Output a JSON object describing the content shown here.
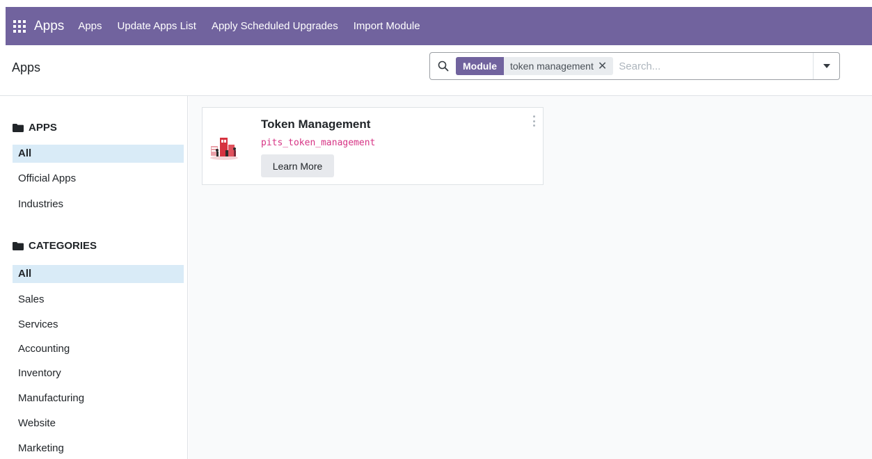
{
  "navbar": {
    "brand": "Apps",
    "menu": [
      "Apps",
      "Update Apps List",
      "Apply Scheduled Upgrades",
      "Import Module"
    ]
  },
  "control_panel": {
    "breadcrumb": "Apps",
    "search": {
      "facet_label": "Module",
      "facet_value": "token management",
      "facet_remove": "✕",
      "placeholder": "Search..."
    }
  },
  "sidebar": {
    "apps_header": "APPS",
    "apps_items": [
      {
        "label": "All",
        "active": true
      },
      {
        "label": "Official Apps",
        "active": false
      },
      {
        "label": "Industries",
        "active": false
      }
    ],
    "categories_header": "CATEGORIES",
    "category_items": [
      {
        "label": "All",
        "active": true
      },
      {
        "label": "Sales",
        "active": false
      },
      {
        "label": "Services",
        "active": false
      },
      {
        "label": "Accounting",
        "active": false
      },
      {
        "label": "Inventory",
        "active": false
      },
      {
        "label": "Manufacturing",
        "active": false
      },
      {
        "label": "Website",
        "active": false
      },
      {
        "label": "Marketing",
        "active": false
      }
    ]
  },
  "module_card": {
    "title": "Token Management",
    "technical_name": "pits_token_management",
    "button_label": "Learn More"
  },
  "colors": {
    "brand": "#71639e",
    "active_item_bg": "#d9ebf7",
    "technical_name": "#d63384"
  }
}
